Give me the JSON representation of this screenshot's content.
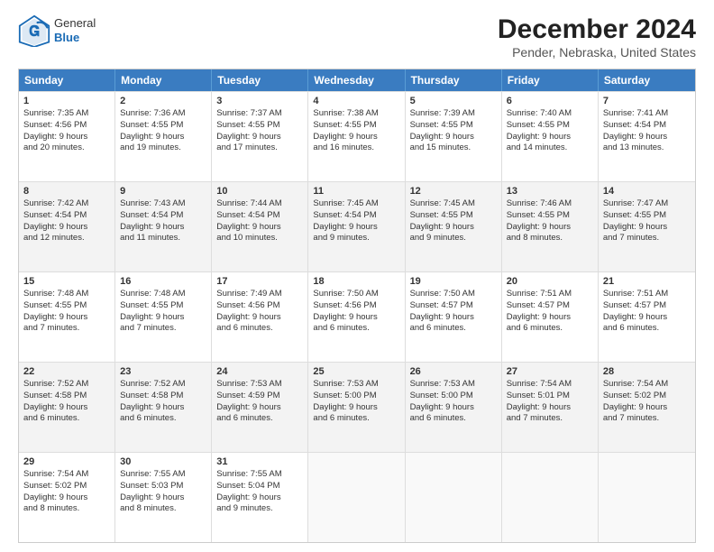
{
  "header": {
    "logo_general": "General",
    "logo_blue": "Blue",
    "title": "December 2024",
    "subtitle": "Pender, Nebraska, United States"
  },
  "days_of_week": [
    "Sunday",
    "Monday",
    "Tuesday",
    "Wednesday",
    "Thursday",
    "Friday",
    "Saturday"
  ],
  "weeks": [
    [
      {
        "day": "1",
        "lines": [
          "Sunrise: 7:35 AM",
          "Sunset: 4:56 PM",
          "Daylight: 9 hours",
          "and 20 minutes."
        ]
      },
      {
        "day": "2",
        "lines": [
          "Sunrise: 7:36 AM",
          "Sunset: 4:55 PM",
          "Daylight: 9 hours",
          "and 19 minutes."
        ]
      },
      {
        "day": "3",
        "lines": [
          "Sunrise: 7:37 AM",
          "Sunset: 4:55 PM",
          "Daylight: 9 hours",
          "and 17 minutes."
        ]
      },
      {
        "day": "4",
        "lines": [
          "Sunrise: 7:38 AM",
          "Sunset: 4:55 PM",
          "Daylight: 9 hours",
          "and 16 minutes."
        ]
      },
      {
        "day": "5",
        "lines": [
          "Sunrise: 7:39 AM",
          "Sunset: 4:55 PM",
          "Daylight: 9 hours",
          "and 15 minutes."
        ]
      },
      {
        "day": "6",
        "lines": [
          "Sunrise: 7:40 AM",
          "Sunset: 4:55 PM",
          "Daylight: 9 hours",
          "and 14 minutes."
        ]
      },
      {
        "day": "7",
        "lines": [
          "Sunrise: 7:41 AM",
          "Sunset: 4:54 PM",
          "Daylight: 9 hours",
          "and 13 minutes."
        ]
      }
    ],
    [
      {
        "day": "8",
        "lines": [
          "Sunrise: 7:42 AM",
          "Sunset: 4:54 PM",
          "Daylight: 9 hours",
          "and 12 minutes."
        ]
      },
      {
        "day": "9",
        "lines": [
          "Sunrise: 7:43 AM",
          "Sunset: 4:54 PM",
          "Daylight: 9 hours",
          "and 11 minutes."
        ]
      },
      {
        "day": "10",
        "lines": [
          "Sunrise: 7:44 AM",
          "Sunset: 4:54 PM",
          "Daylight: 9 hours",
          "and 10 minutes."
        ]
      },
      {
        "day": "11",
        "lines": [
          "Sunrise: 7:45 AM",
          "Sunset: 4:54 PM",
          "Daylight: 9 hours",
          "and 9 minutes."
        ]
      },
      {
        "day": "12",
        "lines": [
          "Sunrise: 7:45 AM",
          "Sunset: 4:55 PM",
          "Daylight: 9 hours",
          "and 9 minutes."
        ]
      },
      {
        "day": "13",
        "lines": [
          "Sunrise: 7:46 AM",
          "Sunset: 4:55 PM",
          "Daylight: 9 hours",
          "and 8 minutes."
        ]
      },
      {
        "day": "14",
        "lines": [
          "Sunrise: 7:47 AM",
          "Sunset: 4:55 PM",
          "Daylight: 9 hours",
          "and 7 minutes."
        ]
      }
    ],
    [
      {
        "day": "15",
        "lines": [
          "Sunrise: 7:48 AM",
          "Sunset: 4:55 PM",
          "Daylight: 9 hours",
          "and 7 minutes."
        ]
      },
      {
        "day": "16",
        "lines": [
          "Sunrise: 7:48 AM",
          "Sunset: 4:55 PM",
          "Daylight: 9 hours",
          "and 7 minutes."
        ]
      },
      {
        "day": "17",
        "lines": [
          "Sunrise: 7:49 AM",
          "Sunset: 4:56 PM",
          "Daylight: 9 hours",
          "and 6 minutes."
        ]
      },
      {
        "day": "18",
        "lines": [
          "Sunrise: 7:50 AM",
          "Sunset: 4:56 PM",
          "Daylight: 9 hours",
          "and 6 minutes."
        ]
      },
      {
        "day": "19",
        "lines": [
          "Sunrise: 7:50 AM",
          "Sunset: 4:57 PM",
          "Daylight: 9 hours",
          "and 6 minutes."
        ]
      },
      {
        "day": "20",
        "lines": [
          "Sunrise: 7:51 AM",
          "Sunset: 4:57 PM",
          "Daylight: 9 hours",
          "and 6 minutes."
        ]
      },
      {
        "day": "21",
        "lines": [
          "Sunrise: 7:51 AM",
          "Sunset: 4:57 PM",
          "Daylight: 9 hours",
          "and 6 minutes."
        ]
      }
    ],
    [
      {
        "day": "22",
        "lines": [
          "Sunrise: 7:52 AM",
          "Sunset: 4:58 PM",
          "Daylight: 9 hours",
          "and 6 minutes."
        ]
      },
      {
        "day": "23",
        "lines": [
          "Sunrise: 7:52 AM",
          "Sunset: 4:58 PM",
          "Daylight: 9 hours",
          "and 6 minutes."
        ]
      },
      {
        "day": "24",
        "lines": [
          "Sunrise: 7:53 AM",
          "Sunset: 4:59 PM",
          "Daylight: 9 hours",
          "and 6 minutes."
        ]
      },
      {
        "day": "25",
        "lines": [
          "Sunrise: 7:53 AM",
          "Sunset: 5:00 PM",
          "Daylight: 9 hours",
          "and 6 minutes."
        ]
      },
      {
        "day": "26",
        "lines": [
          "Sunrise: 7:53 AM",
          "Sunset: 5:00 PM",
          "Daylight: 9 hours",
          "and 6 minutes."
        ]
      },
      {
        "day": "27",
        "lines": [
          "Sunrise: 7:54 AM",
          "Sunset: 5:01 PM",
          "Daylight: 9 hours",
          "and 7 minutes."
        ]
      },
      {
        "day": "28",
        "lines": [
          "Sunrise: 7:54 AM",
          "Sunset: 5:02 PM",
          "Daylight: 9 hours",
          "and 7 minutes."
        ]
      }
    ],
    [
      {
        "day": "29",
        "lines": [
          "Sunrise: 7:54 AM",
          "Sunset: 5:02 PM",
          "Daylight: 9 hours",
          "and 8 minutes."
        ]
      },
      {
        "day": "30",
        "lines": [
          "Sunrise: 7:55 AM",
          "Sunset: 5:03 PM",
          "Daylight: 9 hours",
          "and 8 minutes."
        ]
      },
      {
        "day": "31",
        "lines": [
          "Sunrise: 7:55 AM",
          "Sunset: 5:04 PM",
          "Daylight: 9 hours",
          "and 9 minutes."
        ]
      },
      {
        "day": "",
        "lines": []
      },
      {
        "day": "",
        "lines": []
      },
      {
        "day": "",
        "lines": []
      },
      {
        "day": "",
        "lines": []
      }
    ]
  ]
}
